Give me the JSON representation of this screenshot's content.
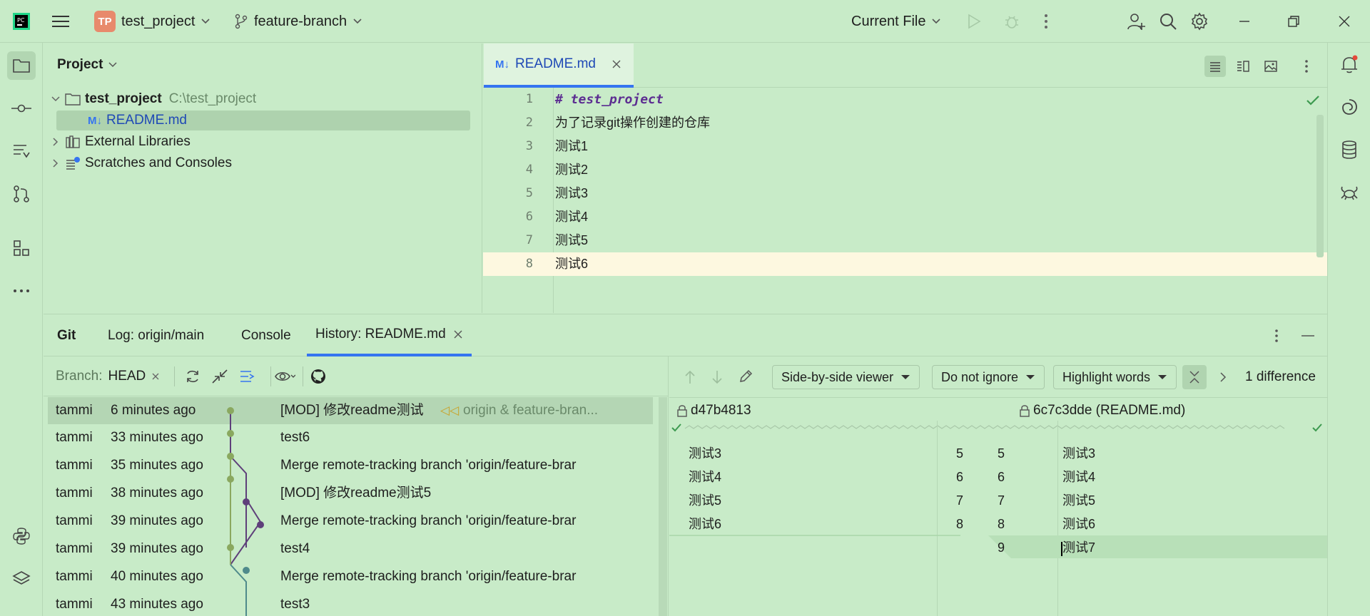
{
  "titlebar": {
    "project_badge": "TP",
    "project_name": "test_project",
    "branch": "feature-branch",
    "run_config": "Current File"
  },
  "project_panel": {
    "title": "Project",
    "tree": [
      {
        "label": "test_project",
        "path": "C:\\test_project",
        "icon": "folder-icon"
      },
      {
        "label": "README.md",
        "icon": "markdown-file-icon"
      },
      {
        "label": "External Libraries",
        "icon": "library-icon"
      },
      {
        "label": "Scratches and Consoles",
        "icon": "scratches-icon"
      }
    ]
  },
  "editor": {
    "tab_label": "README.md",
    "lines": [
      {
        "num": "1",
        "text": "# test_project"
      },
      {
        "num": "2",
        "text": "为了记录git操作创建的仓库"
      },
      {
        "num": "3",
        "text": "测试1"
      },
      {
        "num": "4",
        "text": "测试2"
      },
      {
        "num": "5",
        "text": "测试3"
      },
      {
        "num": "6",
        "text": "测试4"
      },
      {
        "num": "7",
        "text": "测试5"
      },
      {
        "num": "8",
        "text": "测试6"
      }
    ]
  },
  "bottom": {
    "tabs": [
      "Git",
      "Log: origin/main",
      "Console",
      "History: README.md"
    ],
    "branch_label": "Branch:",
    "branch_value": "HEAD",
    "commits": [
      {
        "author": "tammi",
        "time": "6 minutes ago",
        "message": "[MOD] 修改readme测试",
        "refs": "origin & feature-bran..."
      },
      {
        "author": "tammi",
        "time": "33 minutes ago",
        "message": "test6"
      },
      {
        "author": "tammi",
        "time": "35 minutes ago",
        "message": "Merge remote-tracking branch 'origin/feature-brar"
      },
      {
        "author": "tammi",
        "time": "38 minutes ago",
        "message": "[MOD] 修改readme测试5"
      },
      {
        "author": "tammi",
        "time": "39 minutes ago",
        "message": "Merge remote-tracking branch 'origin/feature-brar"
      },
      {
        "author": "tammi",
        "time": "39 minutes ago",
        "message": "test4"
      },
      {
        "author": "tammi",
        "time": "40 minutes ago",
        "message": "Merge remote-tracking branch 'origin/feature-brar"
      },
      {
        "author": "tammi",
        "time": "43 minutes ago",
        "message": "test3"
      }
    ]
  },
  "diff": {
    "viewer": "Side-by-side viewer",
    "ignore": "Do not ignore",
    "highlight": "Highlight words",
    "difference_count": "1 difference",
    "left_rev": "d47b4813",
    "right_rev": "6c7c3dde (README.md)",
    "left_lines": [
      {
        "num": "5",
        "text": "测试3"
      },
      {
        "num": "6",
        "text": "测试4"
      },
      {
        "num": "7",
        "text": "测试5"
      },
      {
        "num": "8",
        "text": "测试6"
      }
    ],
    "right_lines": [
      {
        "num": "5",
        "text": "测试3"
      },
      {
        "num": "6",
        "text": "测试4"
      },
      {
        "num": "7",
        "text": "测试5"
      },
      {
        "num": "8",
        "text": "测试6"
      },
      {
        "num": "9",
        "text": "测试7"
      }
    ]
  },
  "colors": {
    "background": "#c8ebc8",
    "accent": "#3574f0",
    "graph_green": "#8aa85f",
    "graph_purple": "#5e3f7a",
    "graph_teal": "#4f8a8b",
    "current_line": "#fdf8e0"
  }
}
